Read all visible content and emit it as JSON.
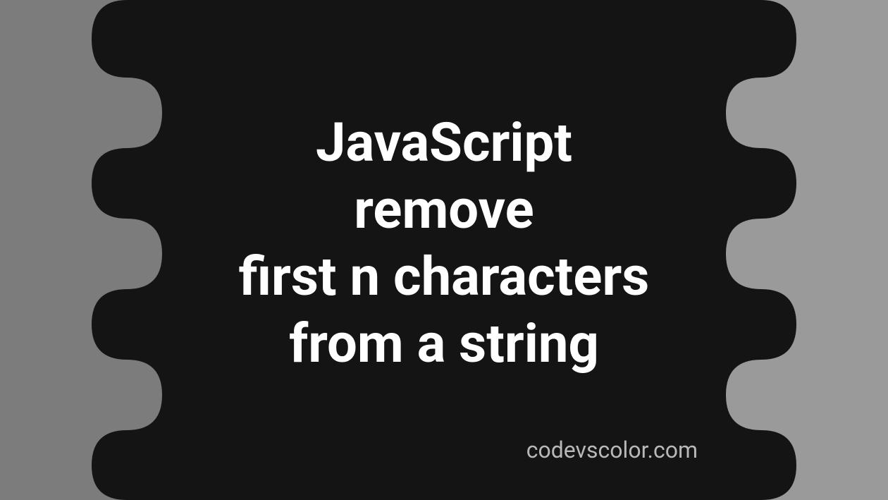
{
  "title_lines": "JavaScript\nremove\nfirst n characters\nfrom a string",
  "attribution": "codevscolor.com",
  "colors": {
    "blob": "#141414",
    "bg_left": "#7c7c7c",
    "bg_right": "#9a9a9a",
    "title": "#ffffff",
    "attribution": "#b8b8b8"
  }
}
